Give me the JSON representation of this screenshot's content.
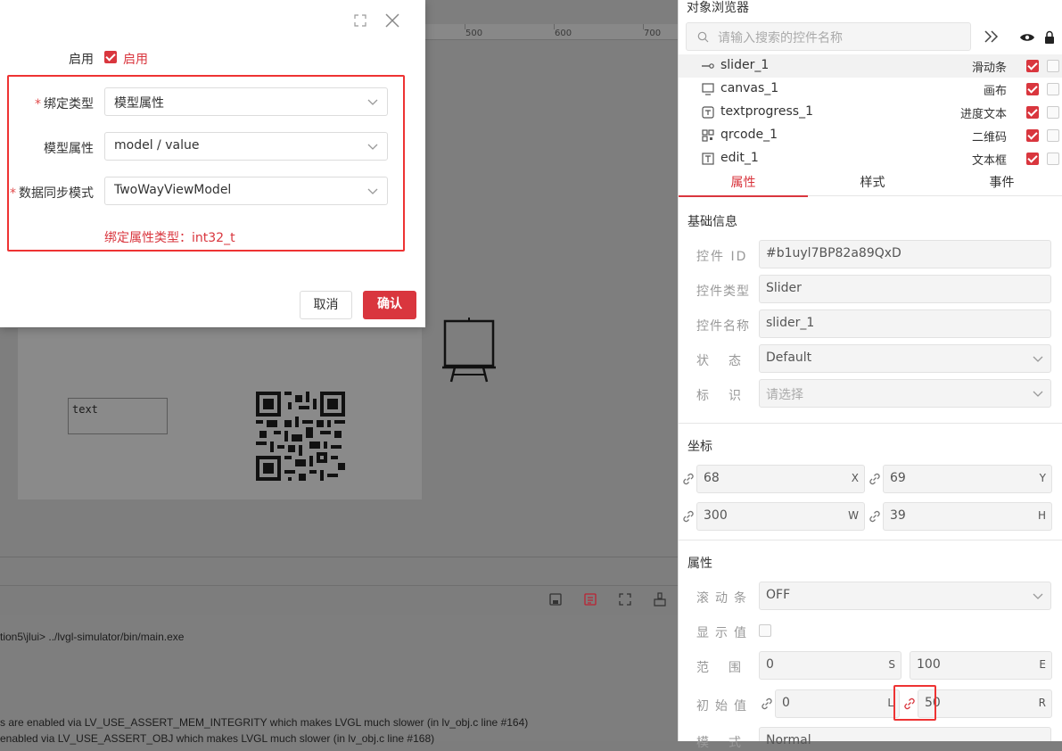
{
  "editor": {
    "ruler_labels": [
      "500",
      "600",
      "700"
    ],
    "textbox_text": "text",
    "console_lines": [
      "tion5\\jlui> ../lvgl-simulator/bin/main.exe",
      "s are enabled via LV_USE_ASSERT_MEM_INTEGRITY which makes LVGL much slower     (in lv_obj.c line #164)",
      "enabled via LV_USE_ASSERT_OBJ which makes LVGL much slower   (in lv_obj.c line #168)"
    ]
  },
  "dialog": {
    "enable_label": "启用",
    "enable_checkbox_label": "启用",
    "bind_type_label": "绑定类型",
    "bind_type_value": "模型属性",
    "model_prop_label": "模型属性",
    "model_prop_value": "model / value",
    "sync_mode_label": "数据同步模式",
    "sync_mode_value": "TwoWayViewModel",
    "bind_prop_type_hint": "绑定属性类型：int32_t",
    "cancel_label": "取消",
    "confirm_label": "确认",
    "required_mark": "*"
  },
  "panel": {
    "title": "对象浏览器",
    "search_placeholder": "请输入搜索的控件名称",
    "tree": [
      {
        "name": "slider_1",
        "type": "滑动条",
        "icon": "slider-icon"
      },
      {
        "name": "canvas_1",
        "type": "画布",
        "icon": "canvas-icon"
      },
      {
        "name": "textprogress_1",
        "type": "进度文本",
        "icon": "textprogress-icon"
      },
      {
        "name": "qrcode_1",
        "type": "二维码",
        "icon": "qrcode-icon"
      },
      {
        "name": "edit_1",
        "type": "文本框",
        "icon": "textbox-icon"
      }
    ],
    "tabs": [
      "属性",
      "样式",
      "事件"
    ],
    "basic_info_title": "基础信息",
    "id_label": "控件 ID",
    "id_value": "#b1uyl7BP82a89QxD",
    "type_label": "控件类型",
    "type_value": "Slider",
    "name_label": "控件名称",
    "name_value": "slider_1",
    "state_label": "状态",
    "state_value": "Default",
    "tag_label": "标识",
    "tag_placeholder": "请选择",
    "coord_title": "坐标",
    "x_value": "68",
    "x_suffix": "X",
    "y_value": "69",
    "y_suffix": "Y",
    "w_value": "300",
    "w_suffix": "W",
    "h_value": "39",
    "h_suffix": "H",
    "props_title": "属性",
    "scrollbar_label": "滚动条",
    "scrollbar_value": "OFF",
    "show_value_label": "显示值",
    "range_label": "范围",
    "range_start": "0",
    "range_start_suffix": "S",
    "range_end": "100",
    "range_end_suffix": "E",
    "init_label": "初始值",
    "init_left": "0",
    "init_left_suffix": "L",
    "init_right": "50",
    "init_right_suffix": "R",
    "mode_label": "模式",
    "mode_value": "Normal",
    "accent_color": "#d9363e"
  }
}
